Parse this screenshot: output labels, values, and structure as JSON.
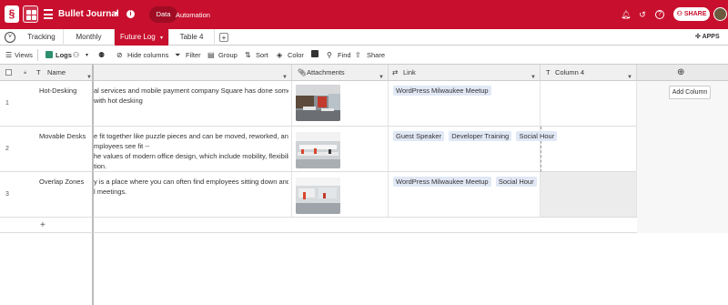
{
  "app": {
    "title": "Bullet Journal",
    "nav": [
      "Data",
      "Automation"
    ],
    "share_label": "SHARE"
  },
  "tabs": {
    "items": [
      "Tracking",
      "Monthly",
      "Future Log",
      "Table 4"
    ],
    "active": "Future Log",
    "apps_label": "APPS"
  },
  "toolbar": {
    "views_label": "Views",
    "view_name": "Logs",
    "hide_columns": "Hide columns",
    "filter": "Filter",
    "group": "Group",
    "sort": "Sort",
    "color": "Color",
    "find": "Find",
    "share": "Share"
  },
  "columns": {
    "name": "Name",
    "attachments": "Attachments",
    "link": "Link",
    "column4": "Column 4",
    "add_column": "Add Column"
  },
  "rows": [
    {
      "num": "1",
      "name": "Hot-Desking",
      "lines": [
        "al services and mobile payment company Square has done some experi",
        "with hot desking"
      ],
      "links": [
        "WordPress Milwaukee Meetup"
      ]
    },
    {
      "num": "2",
      "name": "Movable Desks",
      "lines": [
        "e fit together like puzzle pieces and can be moved, reworked, and reatt",
        "mployees see fit --",
        "he values of modern office design, which include mobility, flexibility, an",
        "tion."
      ],
      "links": [
        "Guest Speaker",
        "Developer Training",
        "Social Hour"
      ]
    },
    {
      "num": "3",
      "name": "Overlap Zones",
      "lines": [
        "y is a place where you can often find employees sitting down and havi",
        "l meetings."
      ],
      "links": [
        "WordPress Milwaukee Meetup",
        "Social Hour"
      ]
    }
  ],
  "colors": {
    "brand": "#c8102e",
    "chip": "#e1e8f5"
  }
}
